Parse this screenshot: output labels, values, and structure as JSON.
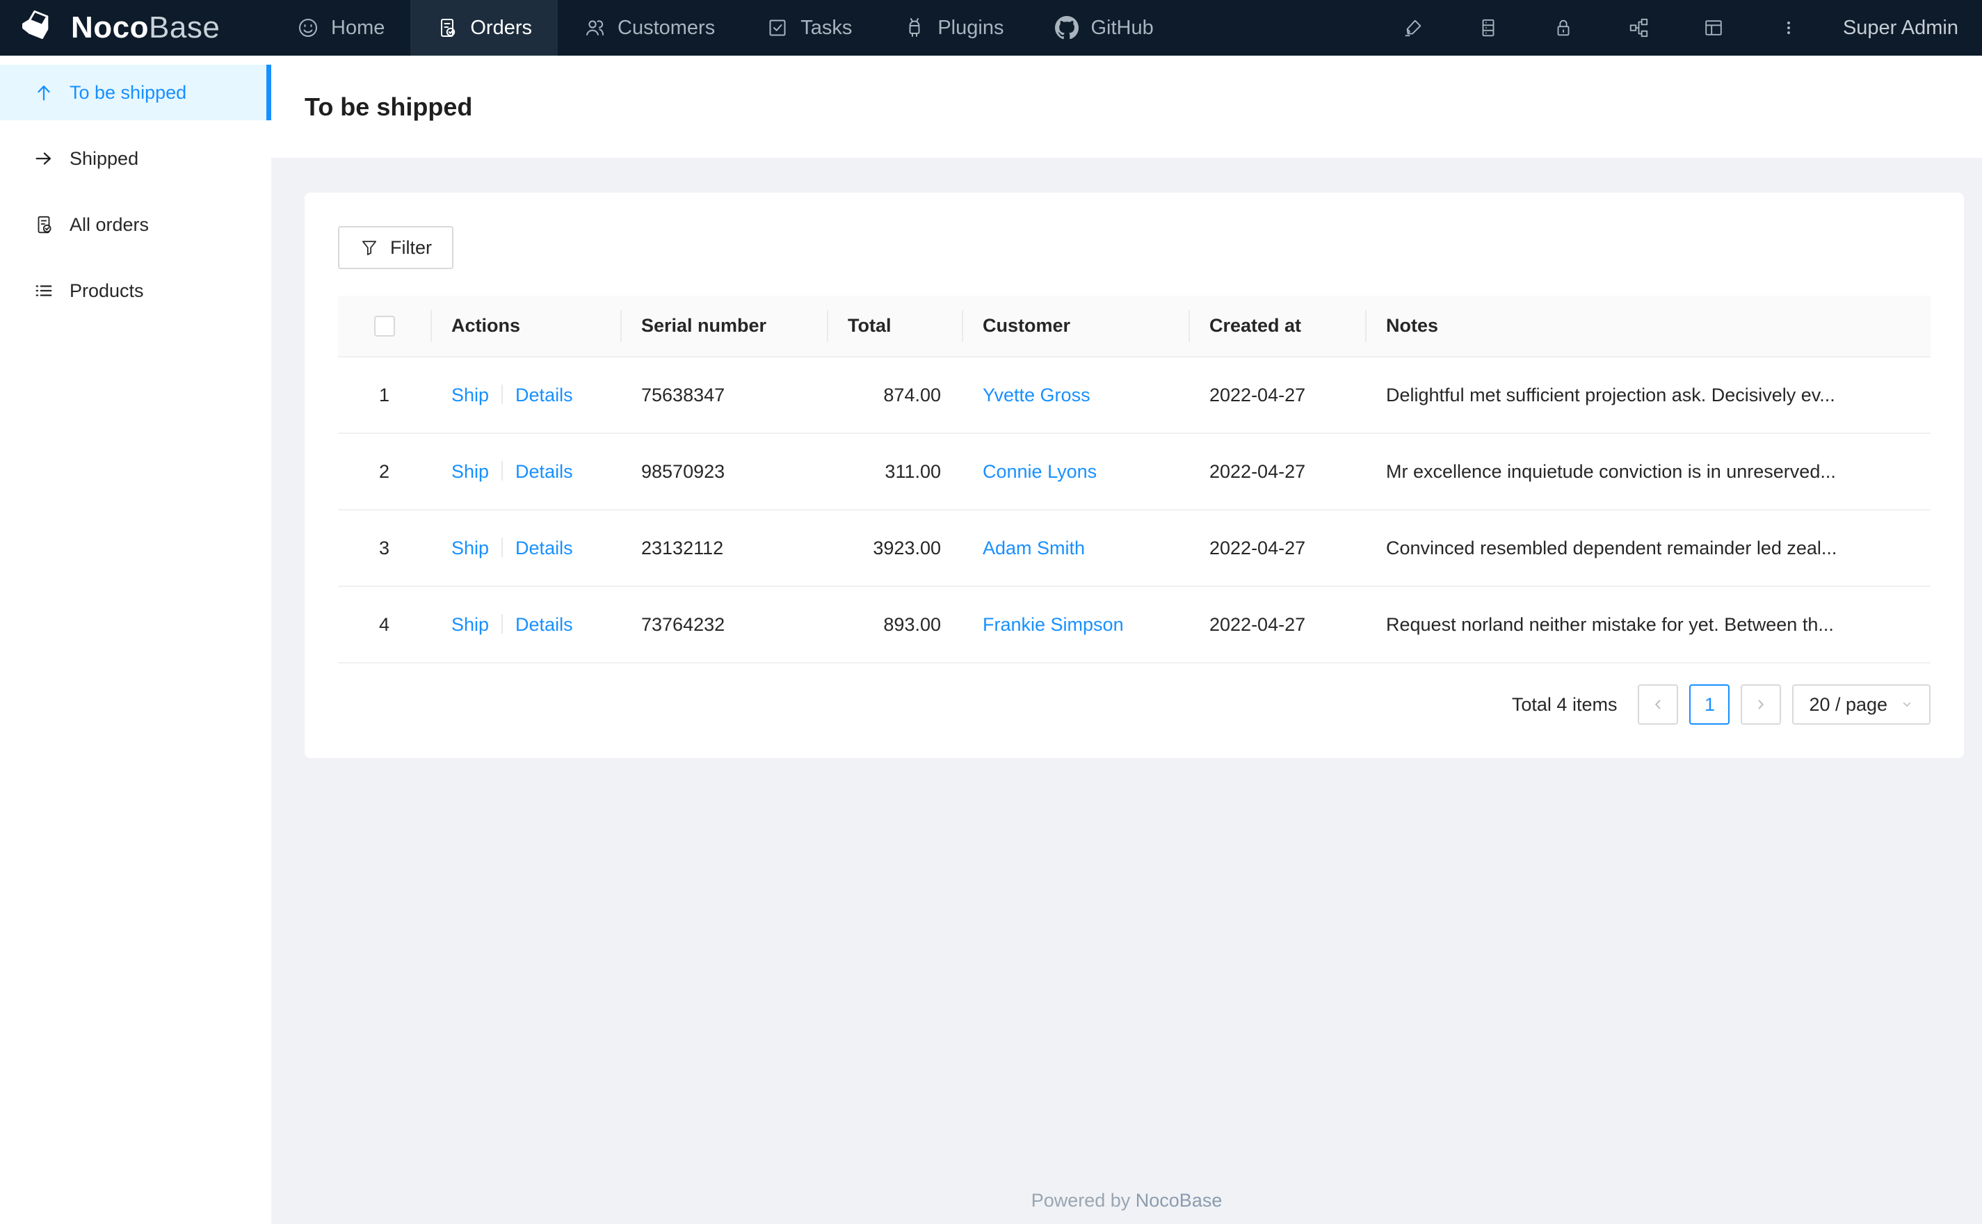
{
  "colors": {
    "accent": "#1890ff",
    "navbar_bg": "#0d1b2a",
    "navbar_active_bg": "#1d2d3d",
    "sidebar_active_bg": "#e6f7ff",
    "page_bg": "#f0f2f5",
    "table_header_bg": "#fafafa"
  },
  "navbar": {
    "logo": {
      "noco": "Noco",
      "base": "Base",
      "mark_icon": "cube-logo-icon"
    },
    "items": [
      {
        "label": "Home",
        "icon": "smile-icon",
        "active": false
      },
      {
        "label": "Orders",
        "icon": "file-done-icon",
        "active": true
      },
      {
        "label": "Customers",
        "icon": "team-icon",
        "active": false
      },
      {
        "label": "Tasks",
        "icon": "check-square-icon",
        "active": false
      },
      {
        "label": "Plugins",
        "icon": "robot-icon",
        "active": false
      },
      {
        "label": "GitHub",
        "icon": "github-icon",
        "active": false
      }
    ],
    "right_icons": [
      "highlighter-icon",
      "database-icon",
      "lock-icon",
      "partition-icon",
      "layout-icon",
      "more-vertical-icon"
    ],
    "user": "Super Admin"
  },
  "sidebar": {
    "items": [
      {
        "label": "To be shipped",
        "icon": "arrow-up-icon",
        "active": true
      },
      {
        "label": "Shipped",
        "icon": "arrow-right-icon",
        "active": false
      },
      {
        "label": "All orders",
        "icon": "file-done-icon",
        "active": false
      },
      {
        "label": "Products",
        "icon": "unordered-list-icon",
        "active": false
      }
    ]
  },
  "page": {
    "title": "To be shipped"
  },
  "toolbar": {
    "filter_label": "Filter",
    "filter_icon": "funnel-icon"
  },
  "table": {
    "columns": [
      "",
      "Actions",
      "Serial number",
      "Total",
      "Customer",
      "Created at",
      "Notes"
    ],
    "rows": [
      {
        "index": "1",
        "actions": [
          "Ship",
          "Details"
        ],
        "serial": "75638347",
        "total": "874.00",
        "customer": "Yvette Gross",
        "created_at": "2022-04-27",
        "notes": "Delightful met sufficient projection ask. Decisively ev..."
      },
      {
        "index": "2",
        "actions": [
          "Ship",
          "Details"
        ],
        "serial": "98570923",
        "total": "311.00",
        "customer": "Connie Lyons",
        "created_at": "2022-04-27",
        "notes": "Mr excellence inquietude conviction is in unreserved..."
      },
      {
        "index": "3",
        "actions": [
          "Ship",
          "Details"
        ],
        "serial": "23132112",
        "total": "3923.00",
        "customer": "Adam Smith",
        "created_at": "2022-04-27",
        "notes": "Convinced resembled dependent remainder led zeal..."
      },
      {
        "index": "4",
        "actions": [
          "Ship",
          "Details"
        ],
        "serial": "73764232",
        "total": "893.00",
        "customer": "Frankie Simpson",
        "created_at": "2022-04-27",
        "notes": "Request norland neither mistake for yet. Between th..."
      }
    ]
  },
  "pagination": {
    "total_text": "Total 4 items",
    "current_page": "1",
    "page_size_label": "20 / page"
  },
  "footer": {
    "powered_by": "Powered by ",
    "brand": "NocoBase"
  }
}
